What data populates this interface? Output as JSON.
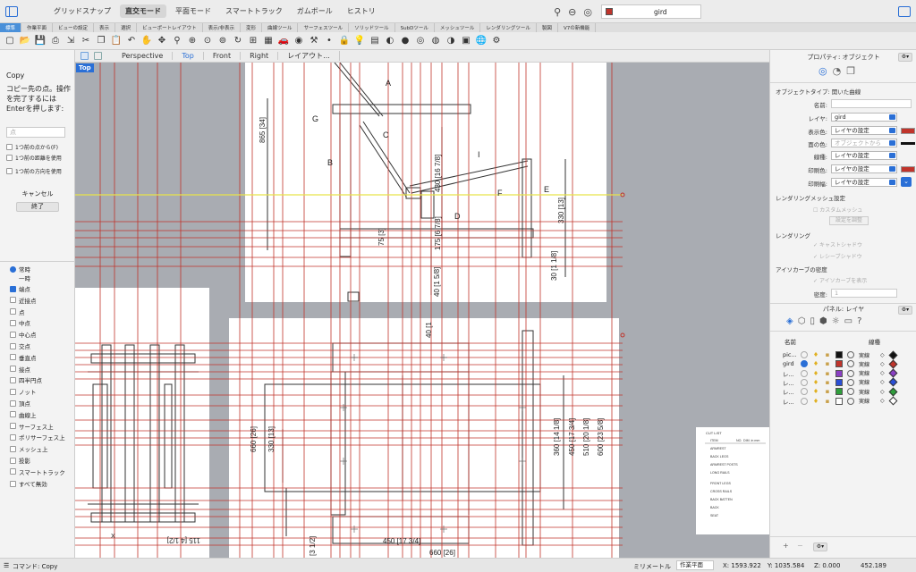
{
  "topbar": {
    "modes": [
      "グリッドスナップ",
      "直交モード",
      "平面モード",
      "スマートトラック",
      "ガムボール",
      "ヒストリ"
    ],
    "active_mode_index": 1,
    "current_layer": "gird",
    "current_layer_color": "#c0342b"
  },
  "tabs": [
    "標準",
    "作業平面",
    "ビューの設定",
    "表示",
    "選択",
    "ビューポートレイアウト",
    "表示/非表示",
    "変形",
    "曲線ツール",
    "サーフェスツール",
    "ソリッドツール",
    "SubDツール",
    "メッシュツール",
    "レンダリングツール",
    "製図",
    "V7の新機能"
  ],
  "active_tab_index": 0,
  "tool_icons": [
    "new-file-icon",
    "open-icon",
    "save-icon",
    "print-icon",
    "import-icon",
    "cut-icon",
    "copy-icon",
    "paste-icon",
    "undo-icon",
    "pan-icon",
    "move-view-icon",
    "zoom-icon",
    "zoom-window-icon",
    "zoom-extents-icon",
    "zoom-selected-icon",
    "rotate-view-icon",
    "4-views-icon",
    "grid-icon",
    "car-icon",
    "eye-icon",
    "tool-icon",
    "point-icon",
    "lock-icon",
    "bulb-icon",
    "layer-icon",
    "color-wheel-icon",
    "render-sphere-icon",
    "sphere-icon",
    "shaded-sphere-icon",
    "dark-sphere-icon",
    "material-icon",
    "globe-icon",
    "gear-icon"
  ],
  "left_panel": {
    "command_title": "Copy",
    "command_desc": "コピー先の点。操作を完了するにはEnterを押します:",
    "input_placeholder": "点",
    "options": [
      "1つ前の点から(F)",
      "1つ前の距離を使用",
      "1つ前の方向を使用"
    ],
    "cancel_label": "キャンセル",
    "finish_label": "終了",
    "osnap_persistent": "常時",
    "osnap_once": "一時",
    "osnaps": [
      {
        "label": "端点",
        "on": true
      },
      {
        "label": "近接点",
        "on": false
      },
      {
        "label": "点",
        "on": false
      },
      {
        "label": "中点",
        "on": false
      },
      {
        "label": "中心点",
        "on": false
      },
      {
        "label": "交点",
        "on": false
      },
      {
        "label": "垂直点",
        "on": false
      },
      {
        "label": "接点",
        "on": false
      },
      {
        "label": "四半円点",
        "on": false
      },
      {
        "label": "ノット",
        "on": false
      },
      {
        "label": "頂点",
        "on": false
      },
      {
        "label": "曲線上",
        "on": false
      },
      {
        "label": "サーフェス上",
        "on": false
      },
      {
        "label": "ポリサーフェス上",
        "on": false
      },
      {
        "label": "メッシュ上",
        "on": false
      },
      {
        "label": "投影",
        "on": false
      },
      {
        "label": "スマートトラック",
        "on": false
      }
    ],
    "disable_all": "すべて無効"
  },
  "viewport": {
    "tabs": [
      "Perspective",
      "Top",
      "Front",
      "Right",
      "レイアウト..."
    ],
    "active_tab_index": 1,
    "label": "Top",
    "drawing_letters": [
      "A",
      "G",
      "C",
      "B",
      "I",
      "F",
      "E",
      "D"
    ],
    "dims": [
      "865 [34]",
      "430 [16 7/8]",
      "175 [6 7/8]",
      "75 [3]",
      "330 [13]",
      "40 [1 5/8]",
      "30 [1 1/8]",
      "40 [1",
      "660 [26]",
      "330 [13]",
      "360 [14 1/8]",
      "450 [17 3/4]",
      "510 [20 1/8]",
      "600 [23 5/8]",
      "450 [17 3/4]",
      "660 [26]",
      "115 [4 1/2]",
      "[3 1/2]",
      "X"
    ],
    "table_headers": [
      "ITEM",
      "NO.",
      "DIM. in mm",
      "CUT LIST"
    ],
    "table_rows": [
      "ARMREST",
      "BACK LEGS",
      "ARMREST POSTS",
      "LONG RAILS",
      "FRONT LEGS",
      "CROSS RAILS",
      "BACK BATTEN",
      "BACK",
      "SEAT"
    ],
    "line_color": "#c0342b",
    "highlight_color": "#e8e34a"
  },
  "properties": {
    "title": "プロパティ: オブジェクト",
    "object_type_label": "オブジェクトタイプ:",
    "object_type_value": "開いた曲線",
    "name_label": "名前:",
    "layer_label": "レイヤ:",
    "layer_value": "gird",
    "display_color_label": "表示色:",
    "display_color_value": "レイヤの設定",
    "display_color_swatch": "#c0342b",
    "face_color_label": "面の色:",
    "face_color_value": "オブジェクトから",
    "linetype_label": "線種:",
    "linetype_value": "レイヤの設定",
    "print_color_label": "印刷色:",
    "print_color_value": "レイヤの設定",
    "print_color_swatch": "#c0342b",
    "print_width_label": "印刷幅:",
    "print_width_value": "レイヤの設定",
    "render_mesh_title": "レンダリングメッシュ設定",
    "custom_mesh": "カスタムメッシュ",
    "adjust_button": "設定を調整",
    "rendering_title": "レンダリング",
    "cast_shadows": "キャストシャドウ",
    "receive_shadows": "レシーブシャドウ",
    "isocurve_title": "アイソカーブの密度",
    "show_isocurves": "アイソカーブを表示",
    "density_label": "密度:",
    "density_value": "1"
  },
  "layers_panel": {
    "title": "パネル: レイヤ",
    "col_name": "名前",
    "col_linetype": "線種",
    "layers": [
      {
        "name": "pic...",
        "color": "#111111",
        "linetype": "実線",
        "diamond": "#111111"
      },
      {
        "name": "gird",
        "color": "#c0342b",
        "linetype": "実線",
        "diamond": "#c0342b"
      },
      {
        "name": "レ...",
        "color": "#8a3fc4",
        "linetype": "実線",
        "diamond": "#8a3fc4"
      },
      {
        "name": "レ...",
        "color": "#2a4fd6",
        "linetype": "実線",
        "diamond": "#2a4fd6"
      },
      {
        "name": "レ...",
        "color": "#2f9e3c",
        "linetype": "実線",
        "diamond": "#2f9e3c"
      },
      {
        "name": "レ...",
        "color": "#ffffff",
        "linetype": "実線",
        "diamond": "#ffffff"
      }
    ]
  },
  "statusbar": {
    "command": "コマンド: Copy",
    "units": "ミリメートル",
    "cplane": "作業平面",
    "x": "X: 1593.922",
    "y": "Y: 1035.584",
    "z": "Z: 0.000",
    "distance": "452.189"
  }
}
